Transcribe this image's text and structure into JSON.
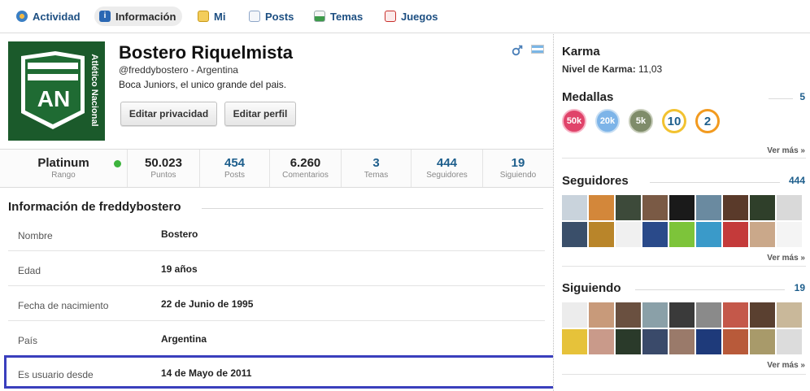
{
  "tabs": [
    {
      "label": "Actividad",
      "icon": "activity-icon",
      "color": "#3b7fc4"
    },
    {
      "label": "Información",
      "icon": "info-icon",
      "color": "#2a67b3"
    },
    {
      "label": "Mi",
      "icon": "chat-icon",
      "color": "#e0a526"
    },
    {
      "label": "Posts",
      "icon": "document-icon",
      "color": "#7a9bc9"
    },
    {
      "label": "Temas",
      "icon": "topics-icon",
      "color": "#3d9b4a"
    },
    {
      "label": "Juegos",
      "icon": "games-icon",
      "color": "#c9302c"
    }
  ],
  "profile": {
    "name": "Bostero Riquelmista",
    "handle": "@freddybostero - Argentina",
    "bio": "Boca Juniors, el unico grande del pais.",
    "avatar_text": "Atlético Nacional",
    "buttons": {
      "privacy": "Editar privacidad",
      "edit": "Editar perfil"
    }
  },
  "stats": [
    {
      "value": "Platinum",
      "label": "Rango"
    },
    {
      "value": "50.023",
      "label": "Puntos"
    },
    {
      "value": "454",
      "label": "Posts"
    },
    {
      "value": "6.260",
      "label": "Comentarios"
    },
    {
      "value": "3",
      "label": "Temas"
    },
    {
      "value": "444",
      "label": "Seguidores"
    },
    {
      "value": "19",
      "label": "Siguiendo"
    }
  ],
  "info": {
    "title": "Información de freddybostero",
    "rows": [
      {
        "key": "Nombre",
        "value": "Bostero"
      },
      {
        "key": "Edad",
        "value": "19 años"
      },
      {
        "key": "Fecha de nacimiento",
        "value": "22 de Junio de 1995"
      },
      {
        "key": "País",
        "value": "Argentina"
      },
      {
        "key": "Es usuario desde",
        "value": "14 de Mayo de 2011"
      }
    ]
  },
  "sidebar": {
    "karma": {
      "title": "Karma",
      "label": "Nivel de Karma:",
      "value": "11,03"
    },
    "medals": {
      "title": "Medallas",
      "count": "5",
      "items": [
        {
          "text": "50k",
          "color": "#e0436a"
        },
        {
          "text": "20k",
          "color": "#7db4e8"
        },
        {
          "text": "5k",
          "color": "#7f8c6a"
        },
        {
          "text": "10",
          "color": "#f2c230"
        },
        {
          "text": "2",
          "color": "#f29a1f"
        }
      ],
      "more": "Ver más »"
    },
    "followers": {
      "title": "Seguidores",
      "count": "444",
      "more": "Ver más »"
    },
    "following": {
      "title": "Siguiendo",
      "count": "19",
      "more": "Ver más »"
    }
  },
  "colors": {
    "link": "#1d5e8c",
    "highlight_border": "#3a3fbd",
    "online": "#3db43d"
  }
}
